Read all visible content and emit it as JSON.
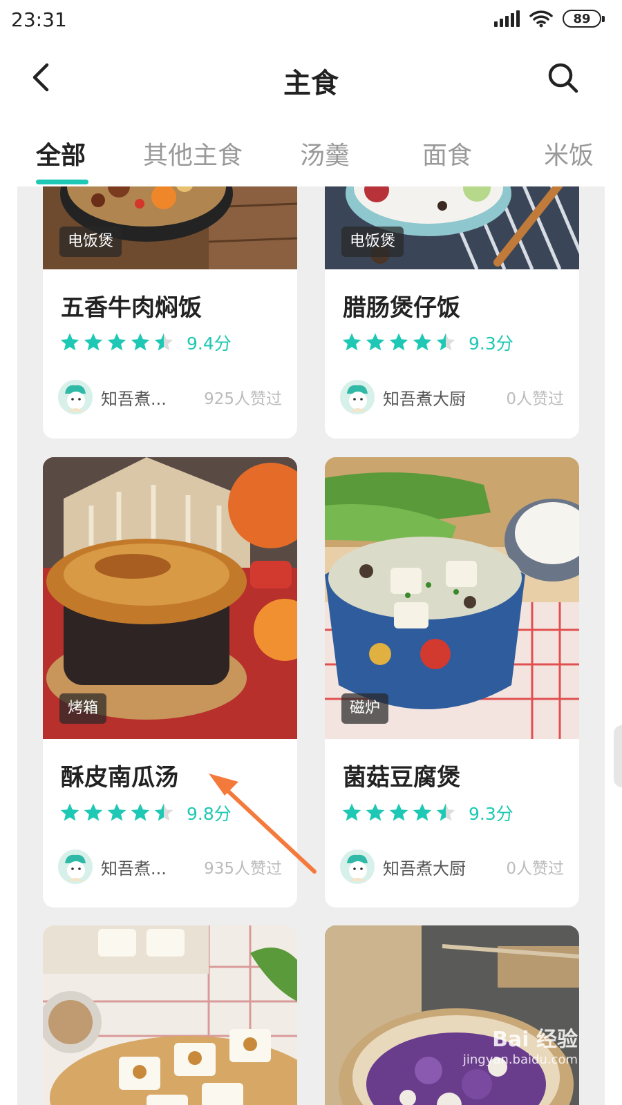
{
  "status": {
    "time": "23:31",
    "battery": "89"
  },
  "header": {
    "title": "主食",
    "back_icon": "back-chevron-icon",
    "search_icon": "search-icon"
  },
  "tabs": [
    "全部",
    "其他主食",
    "汤羹",
    "面食",
    "米饭"
  ],
  "active_tab": 0,
  "cards": [
    {
      "tag": "电饭煲",
      "name": "五香牛肉焖饭",
      "score": "9.4分",
      "author": "知吾煮...",
      "likes": "925人赞过",
      "stars": 4.5
    },
    {
      "tag": "电饭煲",
      "name": "腊肠煲仔饭",
      "score": "9.3分",
      "author": "知吾煮大厨",
      "likes": "0人赞过",
      "stars": 4.5
    },
    {
      "tag": "烤箱",
      "name": "酥皮南瓜汤",
      "score": "9.8分",
      "author": "知吾煮...",
      "likes": "935人赞过",
      "stars": 4.5
    },
    {
      "tag": "磁炉",
      "name": "菌菇豆腐煲",
      "score": "9.3分",
      "author": "知吾煮大厨",
      "likes": "0人赞过",
      "stars": 4.5
    }
  ],
  "watermark": {
    "brand": "Bai 经验",
    "url": "jingyan.baidu.com"
  },
  "colors": {
    "accent": "#1ec8b4",
    "arrow": "#f47a3c"
  }
}
